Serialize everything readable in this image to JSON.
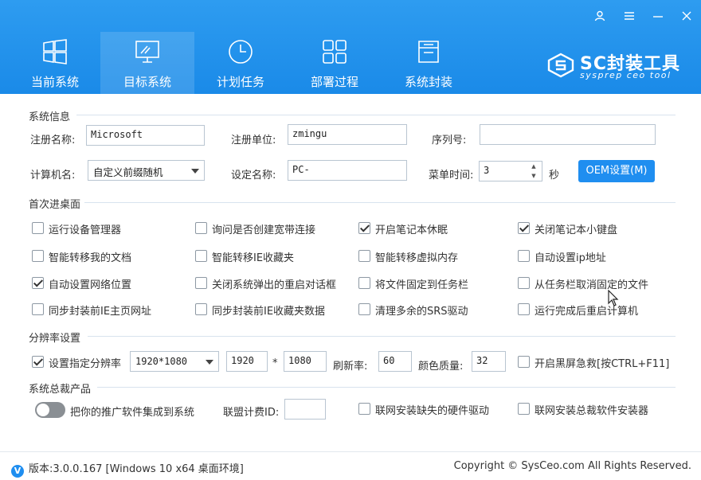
{
  "window_controls": {
    "user": "user-icon",
    "menu": "menu-icon",
    "minimize": "minimize-icon",
    "close": "close-icon"
  },
  "tabs": [
    {
      "label": "当前系统",
      "icon": "windows-icon",
      "active": false
    },
    {
      "label": "目标系统",
      "icon": "monitor-icon",
      "active": true
    },
    {
      "label": "计划任务",
      "icon": "clock-icon",
      "active": false
    },
    {
      "label": "部署过程",
      "icon": "grid-icon",
      "active": false
    },
    {
      "label": "系统封装",
      "icon": "package-icon",
      "active": false
    }
  ],
  "logo": {
    "title": "SC封装工具",
    "subtitle": "sysprep ceo tool"
  },
  "system_info": {
    "section_title": "系统信息",
    "reg_name_label": "注册名称:",
    "reg_name_value": "Microsoft",
    "reg_org_label": "注册单位:",
    "reg_org_value": "zmingu",
    "serial_label": "序列号:",
    "serial_value": "",
    "computer_name_label": "计算机名:",
    "computer_name_value": "自定义前缀随机",
    "setting_name_label": "设定名称:",
    "setting_name_value": "PC-",
    "menu_time_label": "菜单时间:",
    "menu_time_value": "3",
    "seconds_unit": "秒",
    "oem_button": "OEM设置(M)"
  },
  "first_desktop": {
    "section_title": "首次进桌面",
    "options": [
      {
        "label": "运行设备管理器",
        "checked": false
      },
      {
        "label": "询问是否创建宽带连接",
        "checked": false
      },
      {
        "label": "开启笔记本休眠",
        "checked": true
      },
      {
        "label": "关闭笔记本小键盘",
        "checked": true
      },
      {
        "label": "智能转移我的文档",
        "checked": false
      },
      {
        "label": "智能转移IE收藏夹",
        "checked": false
      },
      {
        "label": "智能转移虚拟内存",
        "checked": false
      },
      {
        "label": "自动设置ip地址",
        "checked": false
      },
      {
        "label": "自动设置网络位置",
        "checked": true
      },
      {
        "label": "关闭系统弹出的重启对话框",
        "checked": false
      },
      {
        "label": "将文件固定到任务栏",
        "checked": false
      },
      {
        "label": "从任务栏取消固定的文件",
        "checked": false
      },
      {
        "label": "同步封装前IE主页网址",
        "checked": false
      },
      {
        "label": "同步封装前IE收藏夹数据",
        "checked": false
      },
      {
        "label": "清理多余的SRS驱动",
        "checked": false
      },
      {
        "label": "运行完成后重启计算机",
        "checked": false
      }
    ]
  },
  "resolution": {
    "section_title": "分辨率设置",
    "set_label": "设置指定分辨率",
    "set_checked": true,
    "preset_value": "1920*1080",
    "width_value": "1920",
    "times": "*",
    "height_value": "1080",
    "refresh_label": "刷新率:",
    "refresh_value": "60",
    "color_label": "颜色质量:",
    "color_value": "32",
    "black_screen_label": "开启黑屏急救[按CTRL+F11]",
    "black_screen_checked": false
  },
  "products": {
    "section_title": "系统总裁产品",
    "toggle_label": "把你的推广软件集成到系统",
    "toggle_on": false,
    "alliance_label": "联盟计费ID:",
    "alliance_value": "",
    "hw_driver_label": "联网安装缺失的硬件驱动",
    "hw_driver_checked": false,
    "installer_label": "联网安装总裁软件安装器",
    "installer_checked": false
  },
  "footer": {
    "version": "版本:3.0.0.167 [Windows 10 x64 桌面环境]",
    "copyright": "Copyright © SysCeo.com All Rights Reserved."
  },
  "colors": {
    "header": "#1a8ae8",
    "accent": "#1f8ef0"
  }
}
